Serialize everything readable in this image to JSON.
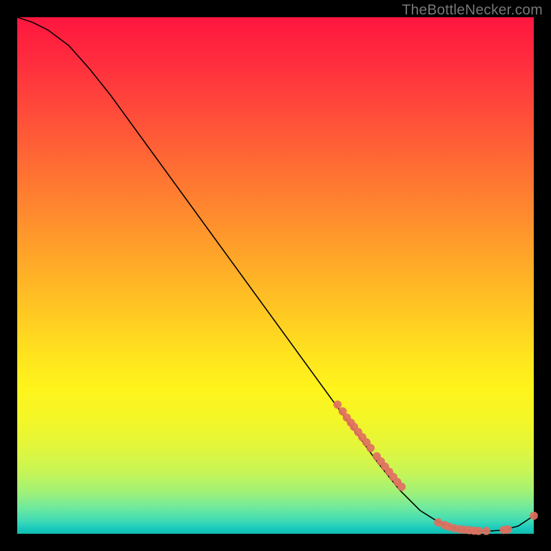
{
  "watermark": "TheBottleNecker.com",
  "chart_data": {
    "type": "line",
    "title": "",
    "xlabel": "",
    "ylabel": "",
    "xlim": [
      0,
      100
    ],
    "ylim": [
      0,
      100
    ],
    "grid": false,
    "series": [
      {
        "name": "curve",
        "color": "#000000",
        "x": [
          0,
          3,
          6,
          10,
          14,
          18,
          22,
          26,
          30,
          34,
          38,
          42,
          46,
          50,
          54,
          58,
          62,
          66,
          70,
          74,
          78,
          82,
          85,
          88,
          91,
          94,
          97,
          100
        ],
        "y": [
          100,
          99,
          97.5,
          94.5,
          90,
          85,
          79.5,
          74,
          68.5,
          63,
          57.5,
          52,
          46.5,
          41,
          35.5,
          30,
          24.5,
          19,
          13.5,
          8.5,
          4.5,
          2.0,
          1.0,
          0.6,
          0.5,
          0.7,
          1.5,
          3.5
        ]
      },
      {
        "name": "points",
        "color": "#e07060",
        "marker": "circle",
        "x": [
          62.0,
          63.0,
          63.8,
          64.6,
          65.2,
          66.0,
          66.8,
          67.6,
          68.4,
          69.6,
          70.4,
          71.2,
          72.0,
          72.8,
          73.6,
          74.4,
          81.5,
          82.7,
          83.5,
          84.5,
          85.6,
          86.5,
          87.5,
          88.4,
          89.3,
          90.8,
          94.2,
          95.0,
          100.0
        ],
        "y": [
          25.0,
          23.7,
          22.5,
          21.5,
          20.7,
          19.7,
          18.7,
          17.7,
          16.6,
          15.0,
          14.0,
          13.0,
          12.0,
          11.0,
          10.0,
          9.1,
          2.2,
          1.7,
          1.4,
          1.1,
          0.9,
          0.8,
          0.7,
          0.6,
          0.55,
          0.55,
          0.75,
          0.85,
          3.5
        ]
      }
    ]
  }
}
